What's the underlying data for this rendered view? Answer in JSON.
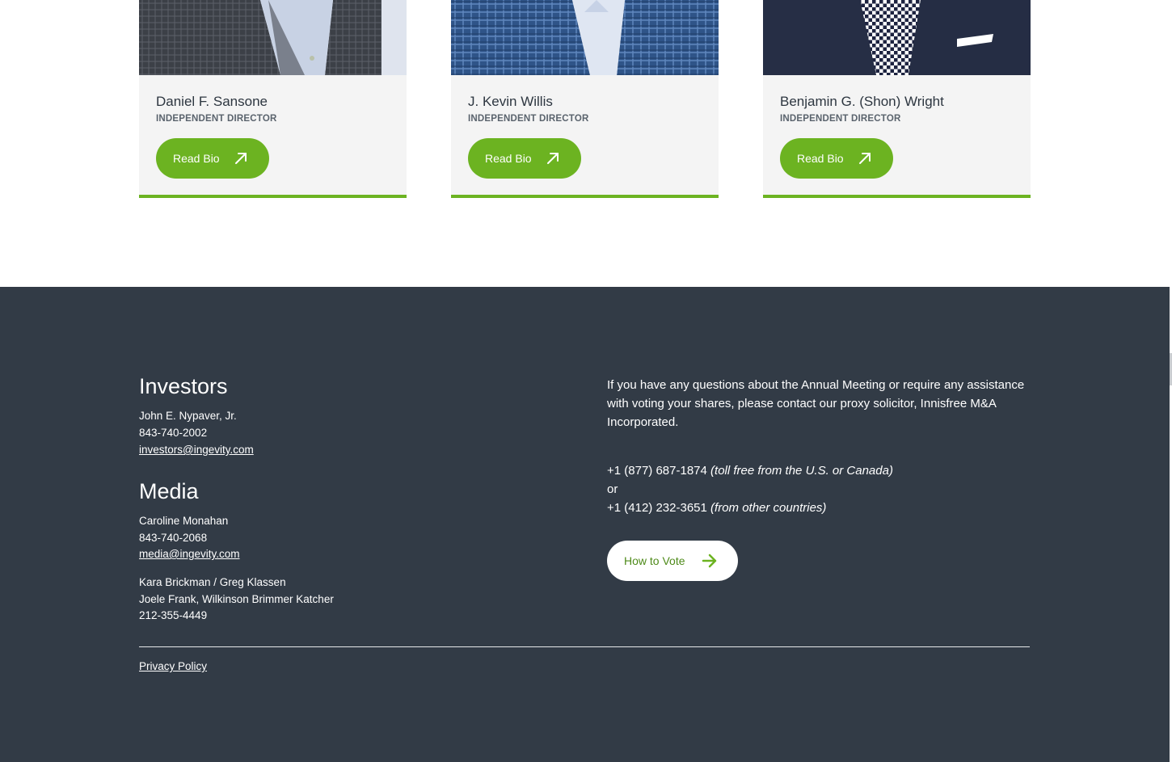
{
  "directors": [
    {
      "name": "Daniel F. Sansone",
      "role": "INDEPENDENT DIRECTOR",
      "button": "Read Bio"
    },
    {
      "name": "J. Kevin Willis",
      "role": "INDEPENDENT DIRECTOR",
      "button": "Read Bio"
    },
    {
      "name": "Benjamin G. (Shon) Wright",
      "role": "INDEPENDENT DIRECTOR",
      "button": "Read Bio"
    }
  ],
  "investors": {
    "heading": "Investors",
    "contact": "John E. Nypaver, Jr.",
    "phone": "843-740-2002",
    "email": "investors@ingevity.com"
  },
  "media": {
    "heading": "Media",
    "contact": "Caroline Monahan",
    "phone": "843-740-2068",
    "email": "media@ingevity.com",
    "agency_contacts": "Kara Brickman / Greg Klassen",
    "agency": "Joele Frank, Wilkinson Brimmer Katcher",
    "agency_phone": "212-355-4449"
  },
  "proxy": {
    "text": "If you have any questions about the Annual Meeting or require any assistance with voting your shares, please contact our proxy solicitor, Innisfree M&A Incorporated.",
    "phone1": "+1 (877) 687-1874",
    "phone1_note": "(toll free from the U.S. or Canada)",
    "or": "or",
    "phone2": "+1 (412) 232-3651",
    "phone2_note": "(from other countries)",
    "button": "How to Vote"
  },
  "footer": {
    "privacy": "Privacy Policy"
  },
  "colors": {
    "accent": "#6cb321",
    "footer_bg": "#323b46",
    "card_bg": "#f4f4f4"
  },
  "icons": {
    "read_bio": "arrow-up-right-icon",
    "vote": "arrow-right-icon"
  }
}
